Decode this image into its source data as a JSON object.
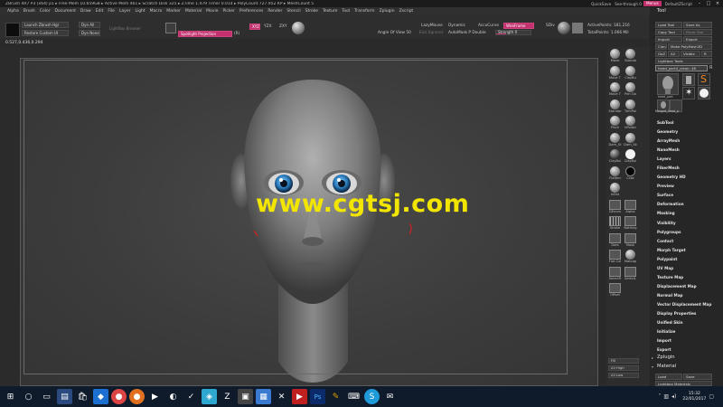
{
  "titlebar": {
    "title": "ZBrush 4R7 P3 (x64)   p1   ▸ Free Mem 10.659GB  ▸ Active Mem 461  ▸ Scratch Disk 325  ▸ ZTime 1.479 Timer 0.014  ▸ PolyCount 727.952 KP  ▸ MeshCount 5",
    "quicksave": "QuickSave",
    "seethrough": "See-through 0",
    "menus": "Menus",
    "script": "DefaultZScript"
  },
  "menubar": [
    "Alpha",
    "Brush",
    "Color",
    "Document",
    "Draw",
    "Edit",
    "File",
    "Layer",
    "Light",
    "Macro",
    "Marker",
    "Material",
    "Movie",
    "Picker",
    "Preferences",
    "Render",
    "Stencil",
    "Stroke",
    "Texture",
    "Tool",
    "Transform",
    "Zplugin",
    "Zscript"
  ],
  "coords": "0.527,0.436,0.294",
  "shelf": {
    "launch": "Launch Zbrush Hgr",
    "restore": "Restore Custom UI",
    "dyn_all": "Dyn All",
    "dyn_none": "Dyn None",
    "lightbox": "LightBox Browser",
    "spotlight": "Spotlight Projection",
    "r_btn": "(R)",
    "xyz": [
      "XYZ",
      "YZX",
      "ZXY"
    ],
    "angle": "Angle Of View 50",
    "lazymouse": "LazyMouse",
    "dynamic": "Dynamic",
    "accucurve": "AccuCurve",
    "wireframe": "WireFrame",
    "ignore": "Exit (Ignore)",
    "automask": "AutoMask P Double",
    "strength": "Strength 0",
    "sdiv": "SDiv",
    "activepoints": "ActivePoints: 181,216",
    "totalpoints": "TotalPoints: 1.066 Mil"
  },
  "watermark": "www.cgtsj.com",
  "toolcol": [
    {
      "label": "Move",
      "icon": "sphere"
    },
    {
      "label": "Standa",
      "icon": "sphere"
    },
    {
      "label": "Move T",
      "icon": "sphere"
    },
    {
      "label": "ClayBu",
      "icon": "sphere"
    },
    {
      "label": "Move T",
      "icon": "sphere"
    },
    {
      "label": "Pen Ga",
      "icon": "sphere"
    },
    {
      "label": "Standar",
      "icon": "sphere"
    },
    {
      "label": "TrimPol",
      "icon": "sphere"
    },
    {
      "label": "Pinch",
      "icon": "sphere"
    },
    {
      "label": "hPolish",
      "icon": "sphere"
    },
    {
      "label": "Dam_St",
      "icon": "sphere"
    },
    {
      "label": "Dam_Sk",
      "icon": "sphere"
    },
    {
      "label": "ClayBui",
      "icon": "dark"
    },
    {
      "label": "ClayBui",
      "icon": "white"
    },
    {
      "label": "Flatten",
      "icon": "sphere"
    },
    {
      "label": "Crak",
      "icon": "black"
    },
    {
      "label": "Inflat",
      "icon": "sphere"
    },
    {
      "label": "DEnum",
      "icon": "box"
    },
    {
      "label": "Alpha",
      "icon": "box"
    },
    {
      "label": "Stroke",
      "icon": "grid"
    },
    {
      "label": "Nothing",
      "icon": "box"
    },
    {
      "label": "Dots",
      "icon": "box"
    },
    {
      "label": "Mask",
      "icon": "box"
    },
    {
      "label": "Flat Col",
      "icon": "box"
    },
    {
      "label": "Matcap",
      "icon": "sphere"
    },
    {
      "label": "SelectR",
      "icon": "box"
    },
    {
      "label": "SelectL",
      "icon": "box"
    },
    {
      "label": "Offset",
      "icon": "box"
    }
  ],
  "toolcol_wide": [
    "Fill",
    "All High",
    "All Low"
  ],
  "panel": {
    "title": "Tool",
    "buttons": [
      "Load Tool",
      "Save As",
      "Copy Tool",
      "Paste Tool",
      "Import",
      "Export",
      "Clone",
      "Make PolyMesh3D",
      "GoZ",
      "All",
      "Visible",
      "R",
      "Lightbox Tools"
    ],
    "current": "head_part4_clean: 48",
    "thumbs": [
      "head_part",
      "Cylinder3D",
      "PolyMesh3D",
      "SimpleBrush",
      "Merged_head_p"
    ],
    "subpalettes": [
      "SubTool",
      "Geometry",
      "ArrayMesh",
      "NanoMesh",
      "Layers",
      "FiberMesh",
      "Geometry HD",
      "Preview",
      "Surface",
      "Deformation",
      "Masking",
      "Visibility",
      "Polygroups",
      "Contact",
      "Morph Target",
      "Polypaint",
      "UV Map",
      "Texture Map",
      "Displacement Map",
      "Normal Map",
      "Vector Displacement Map",
      "Display Properties",
      "Unified Skin",
      "Initialize",
      "Import",
      "Export"
    ],
    "zplugin": "Zplugin",
    "material": "Material",
    "mat_load": "Load",
    "mat_save": "Save",
    "mat_lightbox": "Lightbox Materials"
  },
  "taskbar": {
    "time": "15:32",
    "date": "22/01/2017"
  }
}
